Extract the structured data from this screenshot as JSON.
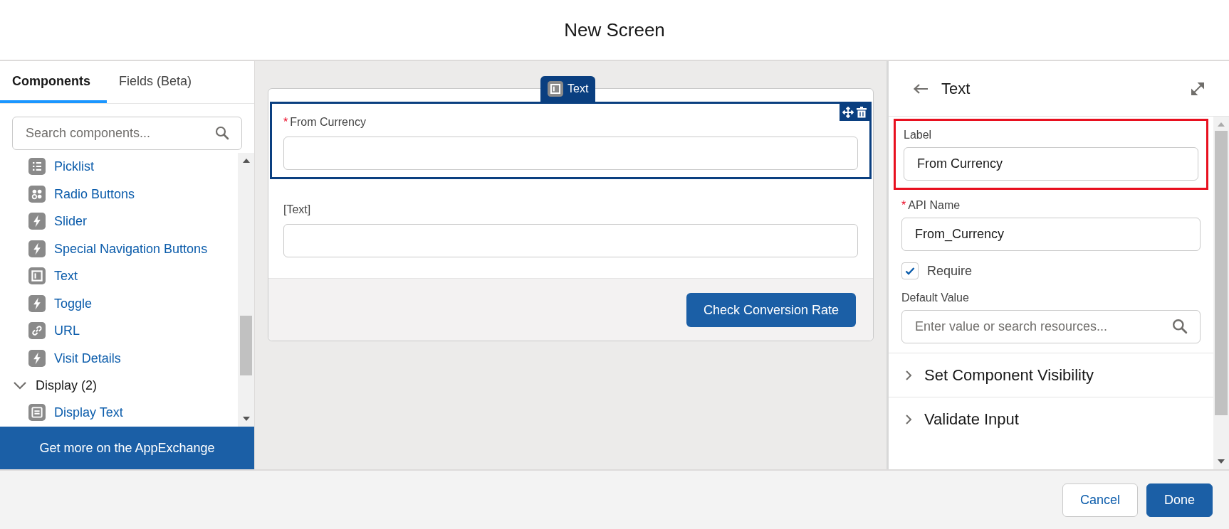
{
  "window": {
    "title": "New Screen"
  },
  "left_panel": {
    "tabs": [
      {
        "label": "Components",
        "selected": true
      },
      {
        "label": "Fields (Beta)",
        "selected": false
      }
    ],
    "search": {
      "placeholder": "Search components..."
    },
    "items": [
      {
        "kind": "picklist",
        "label": "Picklist"
      },
      {
        "kind": "radio",
        "label": "Radio Buttons"
      },
      {
        "kind": "bolt",
        "label": "Slider"
      },
      {
        "kind": "bolt",
        "label": "Special Navigation Buttons"
      },
      {
        "kind": "text",
        "label": "Text"
      },
      {
        "kind": "bolt",
        "label": "Toggle"
      },
      {
        "kind": "link",
        "label": "URL"
      },
      {
        "kind": "bolt",
        "label": "Visit Details"
      },
      {
        "kind": "section",
        "label": "Display (2)",
        "expanded": true
      },
      {
        "kind": "display",
        "label": "Display Text"
      }
    ],
    "appexchange_button": "Get more on the AppExchange"
  },
  "canvas": {
    "component_tab": "Text",
    "fields": [
      {
        "label": "From Currency",
        "required_mark": "*",
        "selected": true
      },
      {
        "label": "[Text]",
        "selected": false
      }
    ],
    "action_button": "Check Conversion Rate"
  },
  "properties": {
    "title": "Text",
    "label_field": {
      "label": "Label",
      "value": "From Currency",
      "highlighted": true
    },
    "api_name": {
      "label": "API Name",
      "value": "From_Currency",
      "required_mark": "*"
    },
    "require": {
      "label": "Require",
      "checked": true
    },
    "default_value": {
      "label": "Default Value",
      "placeholder": "Enter value or search resources..."
    },
    "sections": [
      {
        "label": "Set Component Visibility",
        "expanded": false
      },
      {
        "label": "Validate Input",
        "expanded": false
      }
    ]
  },
  "footer": {
    "buttons": [
      {
        "label": "Cancel",
        "kind": "neutral"
      },
      {
        "label": "Done",
        "kind": "brand"
      }
    ]
  }
}
